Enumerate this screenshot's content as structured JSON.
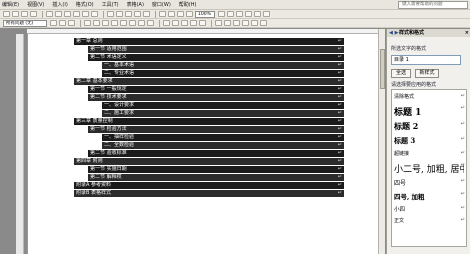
{
  "menu": {
    "items": [
      "编辑(E)",
      "视图(V)",
      "插入(I)",
      "格式(O)",
      "工具(T)",
      "表格(A)",
      "窗口(W)",
      "帮助(H)"
    ],
    "help_box": "键入需要帮助的问题"
  },
  "toolbar": {
    "style_combo": "所有问题 (无)",
    "zoom_combo": "100%"
  },
  "document": {
    "lines": [
      "第一章 总则",
      "第一节 适用范围",
      "第二节 术语定义",
      "一、基本术语",
      "二、专业术语",
      "第二章 基本要求",
      "第一节 一般规定",
      "第二节 技术要求",
      "一、设计要求",
      "二、施工要求",
      "第三章 质量控制",
      "第一节 检验方法",
      "一、抽样检验",
      "二、全数检验",
      "第二节 验收标准",
      "第四章 附则",
      "第一节 实施日期",
      "第二节 解释权",
      "附录A 参考资料",
      "附录B 表格样式"
    ]
  },
  "taskpane": {
    "title": "样式和格式",
    "close": "×",
    "nav": "◀ ▶",
    "selected_label": "所选文字的格式",
    "selected_value": "目录 1",
    "select_all_button": "全选",
    "new_style_button": "新样式",
    "apply_label": "请选择要应用的格式",
    "styles": [
      {
        "label": "清除格式",
        "size": "5px",
        "bold": false
      },
      {
        "label": "标题 1",
        "size": "9px",
        "bold": true
      },
      {
        "label": "标题 2",
        "size": "8px",
        "bold": true
      },
      {
        "label": "标题 3",
        "size": "7px",
        "bold": true
      },
      {
        "label": "超链接",
        "size": "5px",
        "bold": false
      },
      {
        "label": "小二号, 加粗, 居中",
        "size": "9px",
        "bold": false
      },
      {
        "label": "四号",
        "size": "6px",
        "bold": false
      },
      {
        "label": "四号, 加粗",
        "size": "6.5px",
        "bold": true
      },
      {
        "label": "小四",
        "size": "5.5px",
        "bold": false
      },
      {
        "label": "正文",
        "size": "5px",
        "bold": false
      }
    ],
    "mark": "↵"
  },
  "colors": {
    "highlight": "#1b1b1b",
    "page": "#ffffff",
    "chrome": "#ece9e2"
  }
}
